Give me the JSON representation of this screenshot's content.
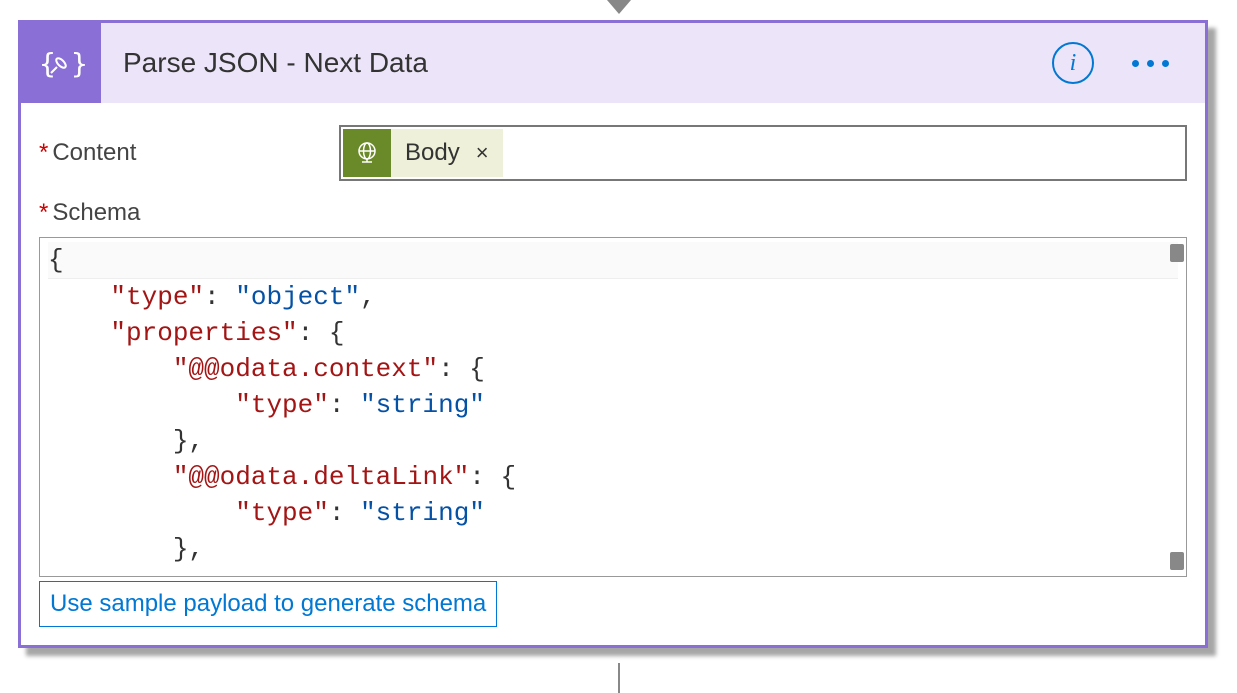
{
  "header": {
    "title": "Parse JSON - Next Data"
  },
  "fields": {
    "content_label": "Content",
    "schema_label": "Schema"
  },
  "token": {
    "label": "Body",
    "remove": "×"
  },
  "schema_lines": {
    "l0": "{",
    "l1_k": "\"type\"",
    "l1_v": "\"object\"",
    "l2_k": "\"properties\"",
    "l3_k": "\"@@odata.context\"",
    "l4_k": "\"type\"",
    "l4_v": "\"string\"",
    "l5": "},",
    "l6_k": "\"@@odata.deltaLink\"",
    "l7_k": "\"type\"",
    "l7_v": "\"string\"",
    "l8": "},"
  },
  "sample_link": "Use sample payload to generate schema",
  "colors": {
    "accent": "#8a6fd6",
    "header_bg": "#ece4f8",
    "link": "#0078d4",
    "token_bg": "#6a8a2a"
  }
}
